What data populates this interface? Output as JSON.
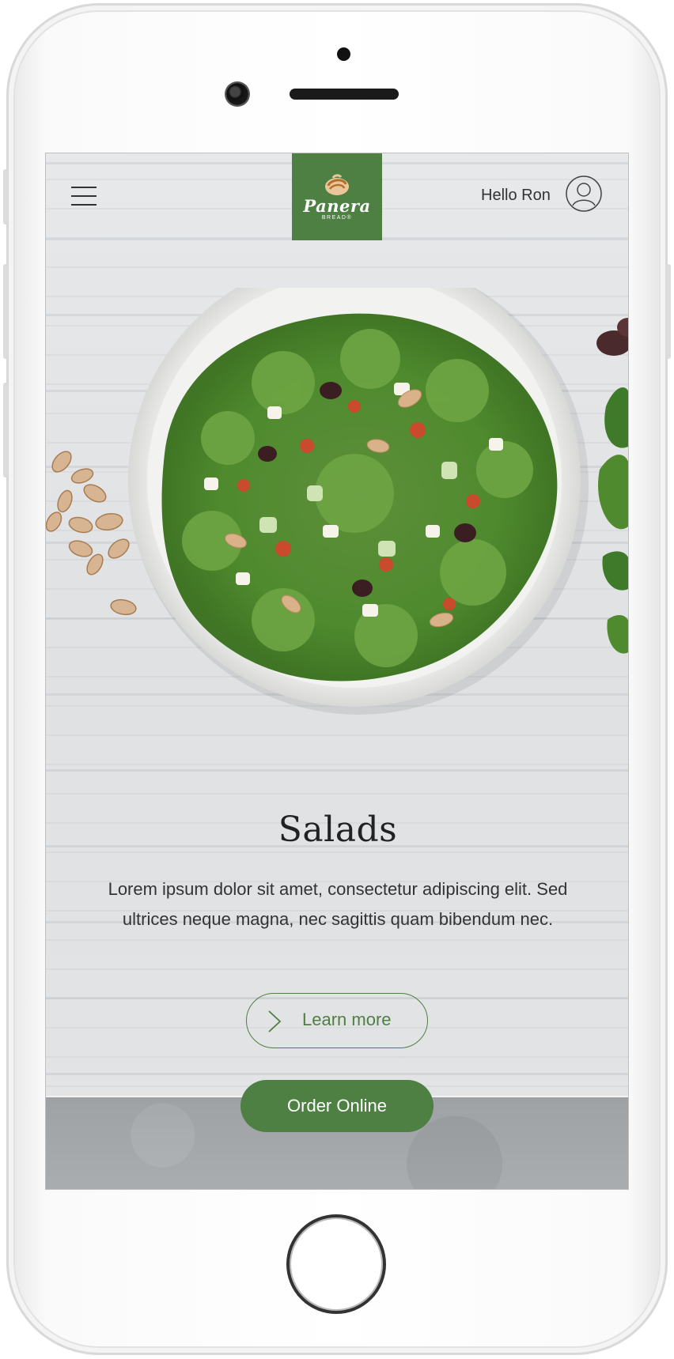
{
  "header": {
    "brand_name": "Panera",
    "brand_sub": "BREAD®",
    "greeting": "Hello Ron"
  },
  "hero": {
    "title": "Salads",
    "description": "Lorem ipsum dolor sit amet, consectetur adipiscing elit. Sed ultrices neque magna, nec sagittis quam bibendum nec.",
    "learn_more_label": "Learn more",
    "order_label": "Order Online"
  },
  "colors": {
    "brand_green": "#4e8043",
    "text_dark": "#222222",
    "wood_bg": "#e2e4e6"
  },
  "icons": {
    "menu": "hamburger-menu-icon",
    "account": "user-profile-icon",
    "arrow": "chevron-right-icon"
  }
}
